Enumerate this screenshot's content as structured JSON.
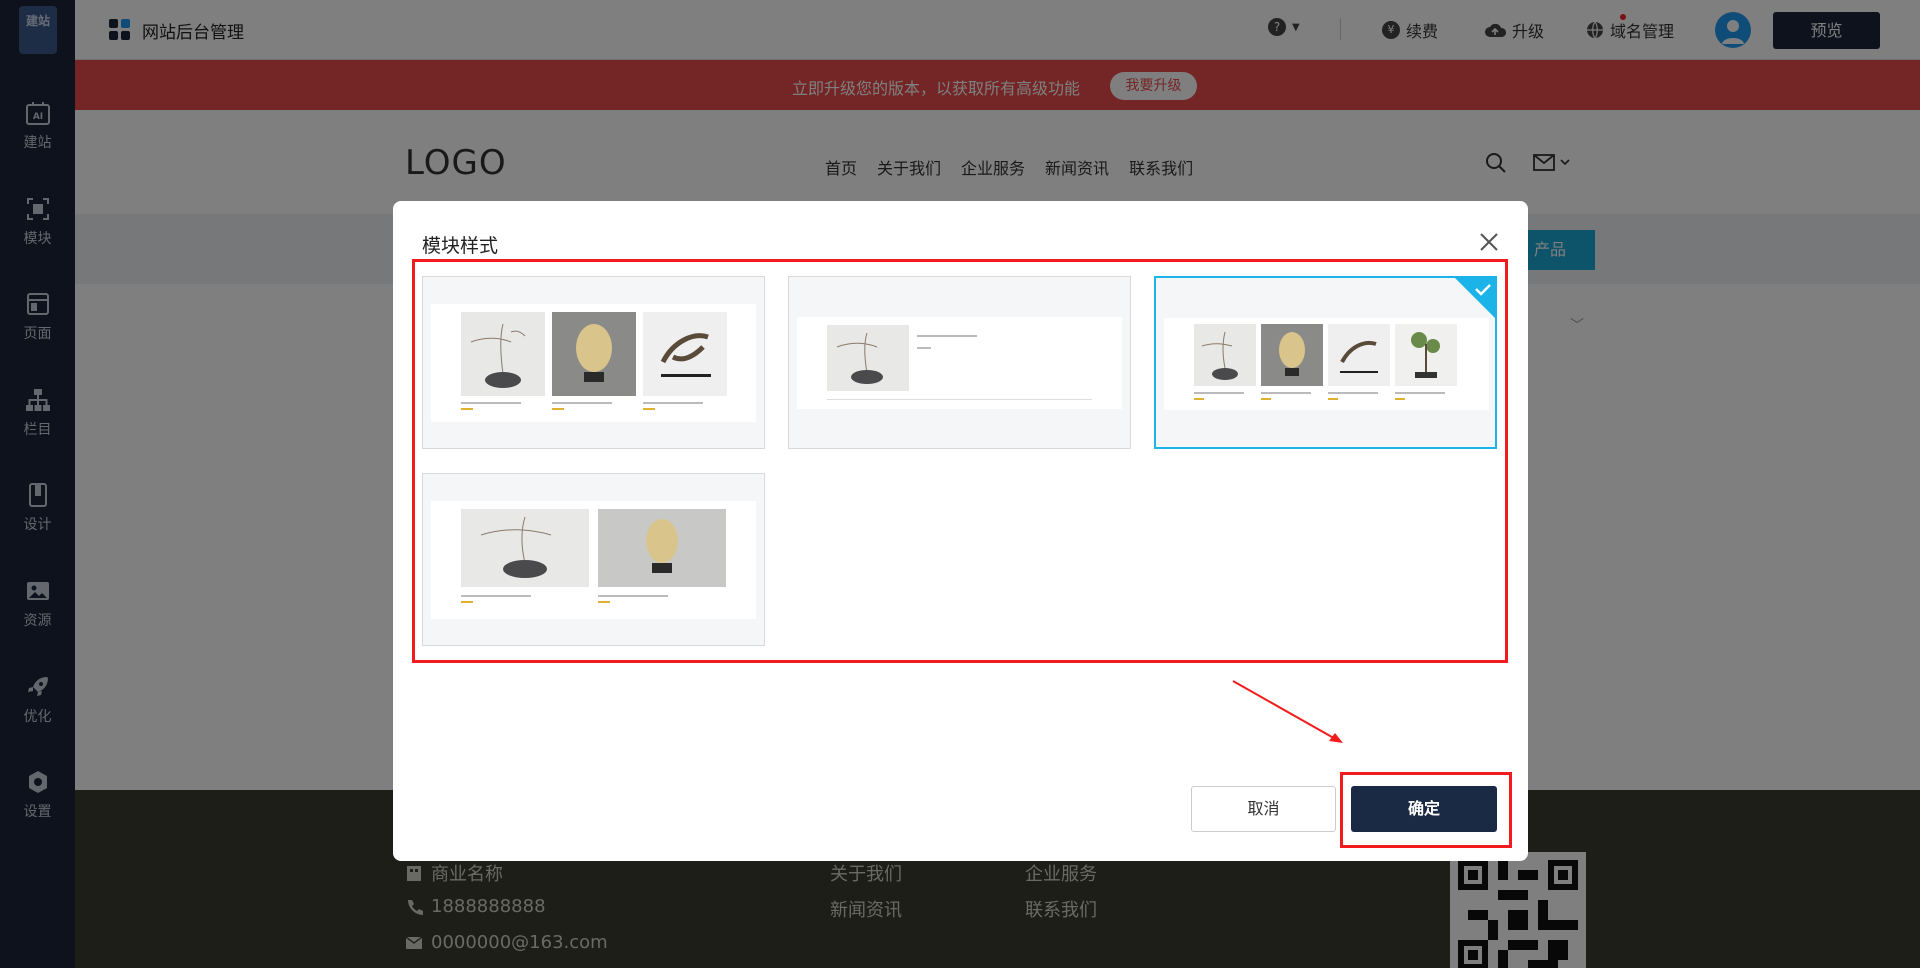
{
  "sidebar": {
    "logo_text": "建站",
    "items": [
      {
        "label": "建站",
        "icon": "ai-icon"
      },
      {
        "label": "模块",
        "icon": "module-icon"
      },
      {
        "label": "页面",
        "icon": "page-icon"
      },
      {
        "label": "栏目",
        "icon": "sitemap-icon"
      },
      {
        "label": "设计",
        "icon": "design-icon"
      },
      {
        "label": "资源",
        "icon": "image-icon"
      },
      {
        "label": "优化",
        "icon": "rocket-icon"
      },
      {
        "label": "设置",
        "icon": "gear-icon"
      }
    ]
  },
  "topbar": {
    "title": "网站后台管理",
    "help": "?",
    "renew": "续费",
    "renew_symbol": "¥",
    "upgrade": "升级",
    "domain": "域名管理",
    "preview": "预览"
  },
  "banner": {
    "text": "立即升级您的版本，以获取所有高级功能",
    "button": "我要升级"
  },
  "site": {
    "logo": "LOGO",
    "nav": [
      "首页",
      "关于我们",
      "企业服务",
      "新闻资讯",
      "联系我们"
    ],
    "product_button": "产品"
  },
  "footer": {
    "company": "商业名称",
    "phone": "1888888888",
    "email": "0000000@163.com",
    "links": [
      "关于我们",
      "企业服务",
      "新闻资讯",
      "联系我们"
    ]
  },
  "modal": {
    "title": "模块样式",
    "styles": [
      {
        "id": "style-1",
        "selected": false
      },
      {
        "id": "style-2",
        "selected": false
      },
      {
        "id": "style-3",
        "selected": true
      },
      {
        "id": "style-4",
        "selected": false
      }
    ],
    "cancel": "取消",
    "confirm": "确定"
  },
  "colors": {
    "sidebar": "#1a2438",
    "banner": "#e94a4a",
    "selected_border": "#1cb3e8",
    "annotation_red": "#f31c1c",
    "confirm": "#1a2a44"
  }
}
